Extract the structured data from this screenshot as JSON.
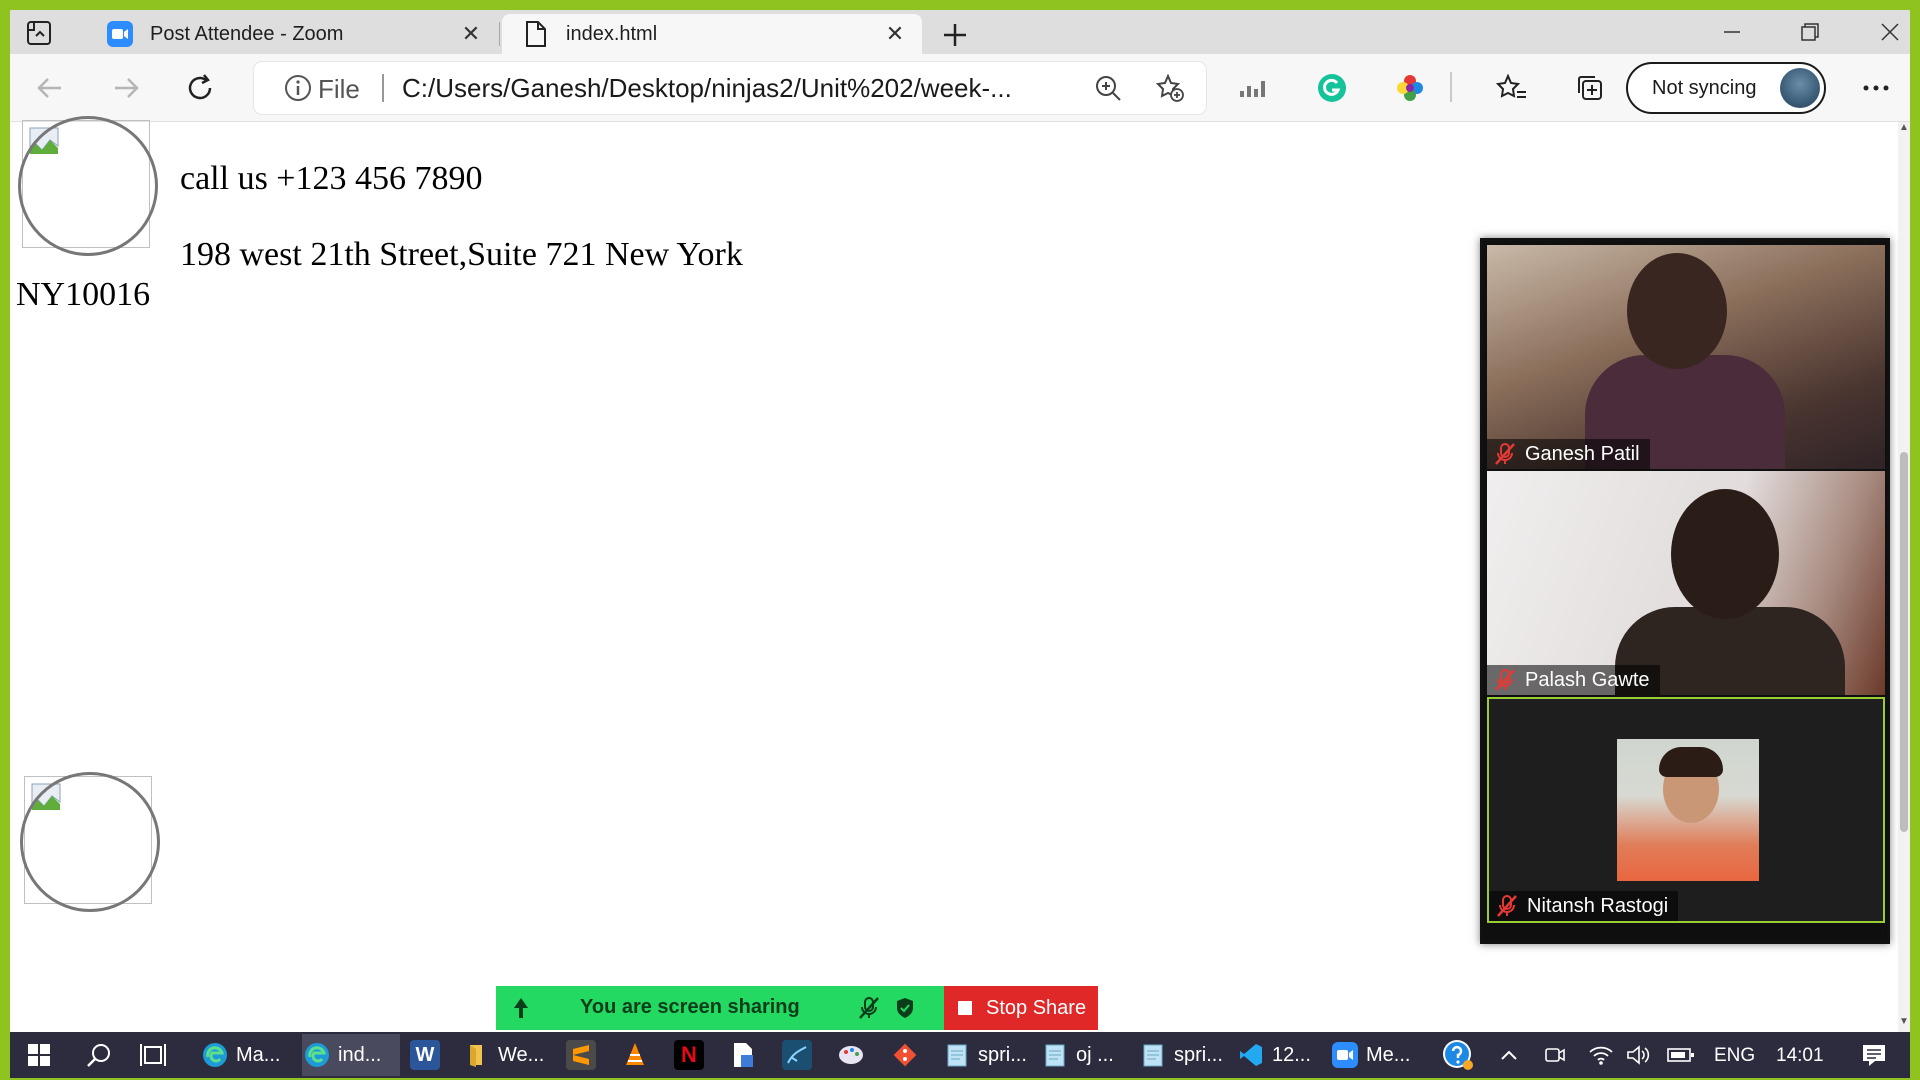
{
  "browser": {
    "tabs": [
      {
        "title": "Post Attendee - Zoom",
        "icon": "zoom-icon"
      },
      {
        "title": "index.html",
        "icon": "file-icon",
        "active": true
      }
    ],
    "address": {
      "scheme": "File",
      "url": "C:/Users/Ganesh/Desktop/ninjas2/Unit%202/week-..."
    },
    "sync_label": "Not syncing"
  },
  "page": {
    "phone": "call us +123 456 7890",
    "address_line1": "198 west 21th Street,Suite 721 New York",
    "address_line2": "NY10016"
  },
  "zoom": {
    "participants": [
      {
        "name": "Ganesh Patil",
        "muted": true
      },
      {
        "name": "Palash Gawte",
        "muted": true
      },
      {
        "name": "Nitansh Rastogi",
        "muted": true
      }
    ],
    "share_label": "You are screen sharing",
    "stop_label": "Stop Share",
    "colors": {
      "share": "#23d961",
      "stop": "#e02828",
      "active_speaker": "#9acd32"
    }
  },
  "taskbar": {
    "items": [
      {
        "label": "Ma...",
        "icon": "edge-icon"
      },
      {
        "label": "ind...",
        "icon": "edge-icon",
        "active": true
      },
      {
        "label": "",
        "icon": "word-icon"
      },
      {
        "label": "We...",
        "icon": "folder-icon"
      },
      {
        "label": "",
        "icon": "sublime-icon"
      },
      {
        "label": "",
        "icon": "vlc-icon"
      },
      {
        "label": "",
        "icon": "netflix-icon"
      },
      {
        "label": "",
        "icon": "document-icon"
      },
      {
        "label": "",
        "icon": "mysql-icon"
      },
      {
        "label": "",
        "icon": "paint-icon"
      },
      {
        "label": "",
        "icon": "git-icon"
      },
      {
        "label": "spri...",
        "icon": "notepad-icon"
      },
      {
        "label": "oj ...",
        "icon": "notepad-icon"
      },
      {
        "label": "spri...",
        "icon": "notepad-icon"
      },
      {
        "label": "12...",
        "icon": "vscode-icon"
      },
      {
        "label": "Me...",
        "icon": "zoom-icon"
      }
    ],
    "language": "ENG",
    "time": "14:01"
  }
}
